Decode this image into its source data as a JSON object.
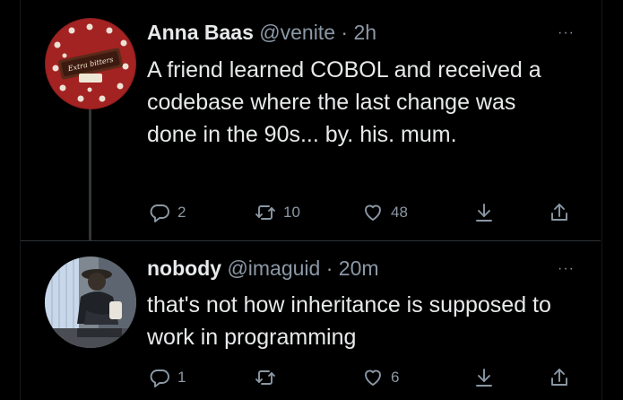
{
  "tweets": [
    {
      "name": "Anna Baas",
      "handle": "@venite",
      "separator": "·",
      "time": "2h",
      "text": "A friend learned COBOL and received a codebase where the last change was done in the 90s... by. his. mum.",
      "avatar_text": "Extra bitters",
      "replies": "2",
      "retweets": "10",
      "likes": "48"
    },
    {
      "name": "nobody",
      "handle": "@imaguid",
      "separator": "·",
      "time": "20m",
      "text": "that's not how inheritance is supposed to work in programming",
      "replies": "1",
      "retweets": "",
      "likes": "6"
    }
  ],
  "more_label": "···",
  "icons": {
    "reply": "reply-icon",
    "retweet": "retweet-icon",
    "like": "heart-icon",
    "bookmark": "bookmark-download-icon",
    "share": "share-icon"
  },
  "colors": {
    "background": "#000000",
    "text": "#e7e9ea",
    "muted": "#8b98a5"
  }
}
